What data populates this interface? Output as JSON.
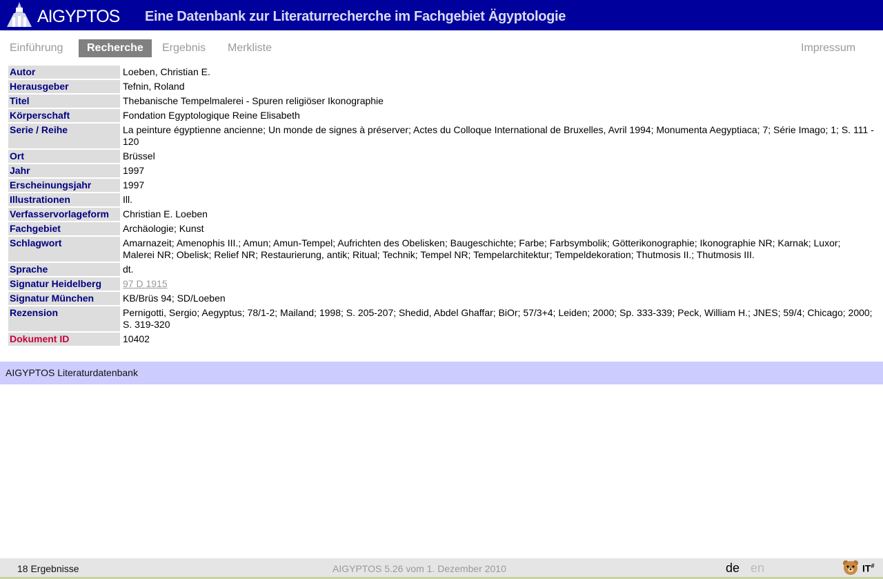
{
  "header": {
    "logo_text": "AIGYPTOS",
    "title": "Eine Datenbank zur Literaturrecherche im Fachgebiet Ägyptologie"
  },
  "nav": {
    "einfuehrung": "Einführung",
    "recherche": "Recherche",
    "ergebnis": "Ergebnis",
    "merkliste": "Merkliste",
    "impressum": "Impressum"
  },
  "record": {
    "autor": {
      "label": "Autor",
      "value": "Loeben, Christian E."
    },
    "herausgeber": {
      "label": "Herausgeber",
      "value": "Tefnin, Roland"
    },
    "titel": {
      "label": "Titel",
      "value": "Thebanische Tempelmalerei - Spuren religiöser Ikonographie"
    },
    "koerperschaft": {
      "label": "Körperschaft",
      "value": "Fondation Egyptologique Reine Elisabeth"
    },
    "serie": {
      "label": "Serie / Reihe",
      "value": "La peinture égyptienne ancienne; Un monde de signes à préserver; Actes du Colloque International de Bruxelles, Avril 1994; Monumenta Aegyptiaca; 7; Série Imago; 1; S. 111 - 120"
    },
    "ort": {
      "label": "Ort",
      "value": "Brüssel"
    },
    "jahr": {
      "label": "Jahr",
      "value": "1997"
    },
    "erscheinungsjahr": {
      "label": "Erscheinungsjahr",
      "value": "1997"
    },
    "illustrationen": {
      "label": "Illustrationen",
      "value": "Ill."
    },
    "verfasservorlageform": {
      "label": "Verfasservorlageform",
      "value": "Christian E. Loeben"
    },
    "fachgebiet": {
      "label": "Fachgebiet",
      "value": "Archäologie; Kunst"
    },
    "schlagwort": {
      "label": "Schlagwort",
      "value": "Amarnazeit; Amenophis III.; Amun; Amun-Tempel; Aufrichten des Obelisken; Baugeschichte; Farbe; Farbsymbolik; Götterikonographie; Ikonographie NR; Karnak; Luxor; Malerei NR; Obelisk; Relief NR; Restaurierung, antik; Ritual; Technik; Tempel NR; Tempelarchitektur; Tempeldekoration; Thutmosis II.; Thutmosis III."
    },
    "sprache": {
      "label": "Sprache",
      "value": "dt."
    },
    "signatur_heidelberg": {
      "label": "Signatur Heidelberg",
      "value": "97 D 1915"
    },
    "signatur_muenchen": {
      "label": "Signatur München",
      "value": "KB/Brüs 94; SD/Loeben"
    },
    "rezension": {
      "label": "Rezension",
      "value": "Pernigotti, Sergio; Aegyptus; 78/1-2; Mailand; 1998; S. 205-207; Shedid, Abdel Ghaffar; BiOr; 57/3+4; Leiden; 2000; Sp. 333-339; Peck, William H.; JNES; 59/4; Chicago; 2000; S. 319-320"
    },
    "dokument_id": {
      "label": "Dokument ID",
      "value": "10402"
    }
  },
  "footer_band": "AIGYPTOS Literaturdatenbank",
  "status": {
    "count": "18 Ergebnisse",
    "version": "AIGYPTOS 5.26 vom 1. Dezember 2010",
    "lang_de": "de",
    "lang_en": "en",
    "it_logo": "IT",
    "it_logo_sup": "#"
  },
  "colors": {
    "header_bg": "#00009c",
    "label_color": "#000080",
    "id_label_color": "#c8003c",
    "footer_band_bg": "#ccccff"
  }
}
